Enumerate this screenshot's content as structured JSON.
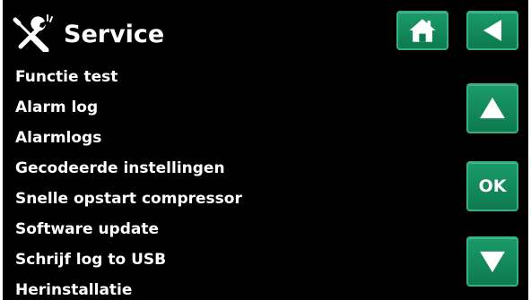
{
  "header": {
    "title": "Service",
    "title_icon": "wrench-screwdriver-icon",
    "home_icon": "home-icon",
    "back_icon": "back-arrow-icon"
  },
  "menu": {
    "items": [
      {
        "label": "Functie test"
      },
      {
        "label": "Alarm log"
      },
      {
        "label": "Alarmlogs"
      },
      {
        "label": "Gecodeerde instellingen"
      },
      {
        "label": "Snelle opstart compressor"
      },
      {
        "label": "Software update"
      },
      {
        "label": "Schrijf log to USB"
      },
      {
        "label": "Herinstallatie"
      }
    ]
  },
  "controls": {
    "up_icon": "arrow-up-icon",
    "ok_label": "OK",
    "down_icon": "arrow-down-icon"
  },
  "colors": {
    "background": "#000000",
    "text": "#ffffff",
    "button": "#0d7a4f",
    "button_border": "#36b083"
  }
}
